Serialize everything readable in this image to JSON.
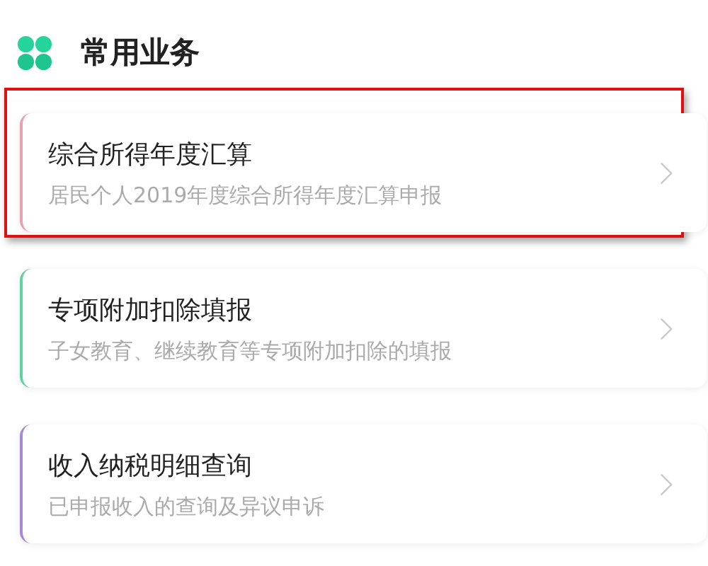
{
  "section": {
    "title": "常用业务"
  },
  "items": [
    {
      "title": "综合所得年度汇算",
      "subtitle": "居民个人2019年度综合所得年度汇算申报",
      "color": "#e8a0b4",
      "highlighted": true
    },
    {
      "title": "专项附加扣除填报",
      "subtitle": "子女教育、继续教育等专项附加扣除的填报",
      "color": "#5fd3a0",
      "highlighted": false
    },
    {
      "title": "收入纳税明细查询",
      "subtitle": "已申报收入的查询及异议申诉",
      "color": "#a58ad8",
      "highlighted": false
    }
  ]
}
